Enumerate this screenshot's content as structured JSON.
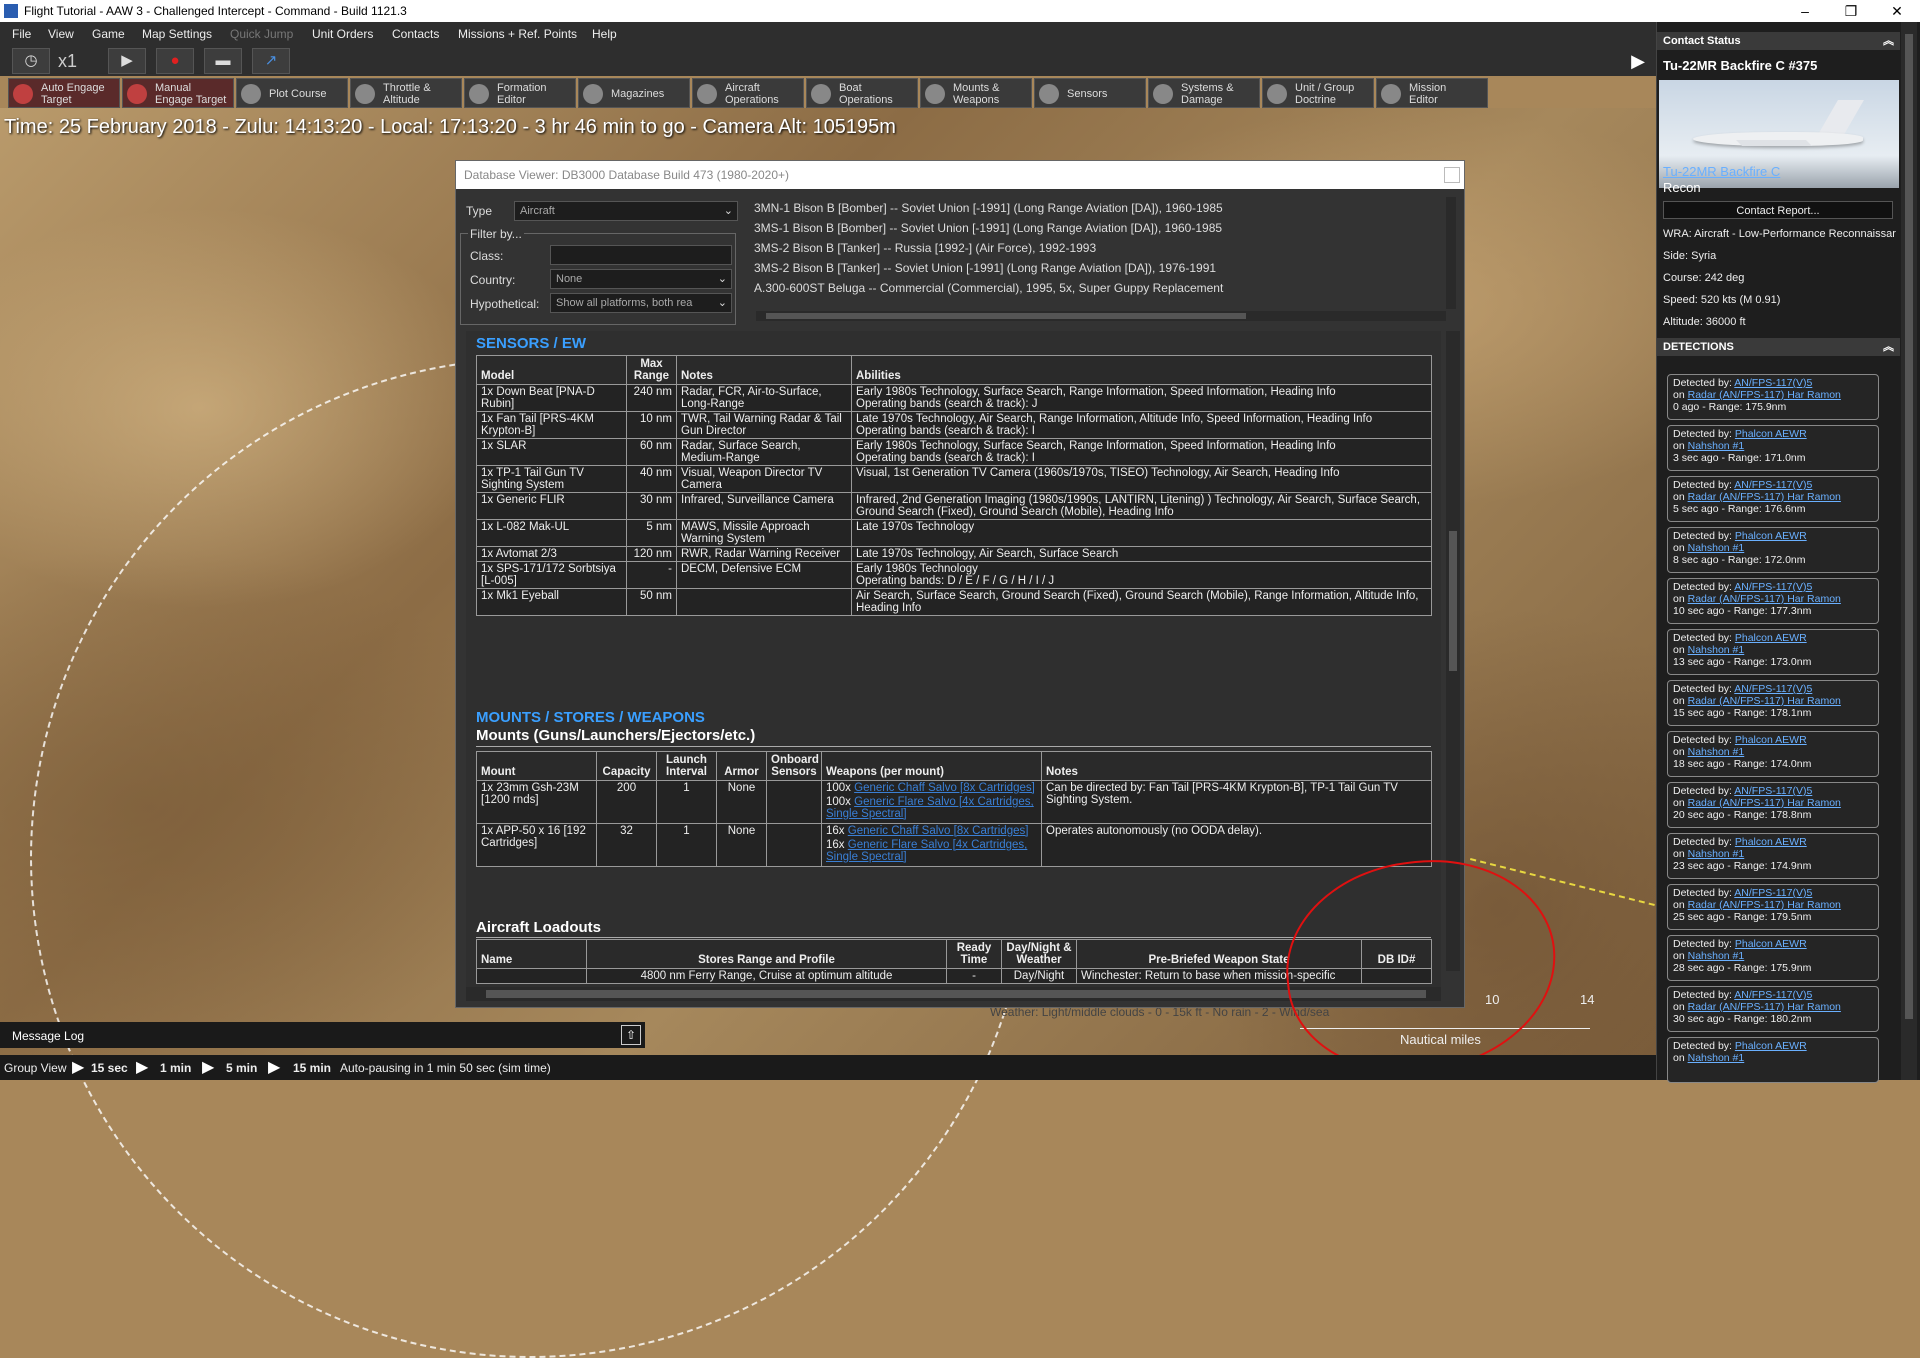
{
  "window": {
    "title": "Flight Tutorial - AAW 3 - Challenged Intercept - Command - Build 1121.3",
    "minimize": "–",
    "maximize": "❐",
    "close": "✕"
  },
  "menu": [
    "File",
    "View",
    "Game",
    "Map Settings",
    "Quick Jump",
    "Unit Orders",
    "Contacts",
    "Missions + Ref. Points",
    "Help"
  ],
  "time_controls": {
    "speed": "x1"
  },
  "toolbar": [
    {
      "label1": "Auto Engage",
      "label2": "Target"
    },
    {
      "label1": "Manual",
      "label2": "Engage Target"
    },
    {
      "label1": "Plot Course",
      "label2": ""
    },
    {
      "label1": "Throttle &",
      "label2": "Altitude"
    },
    {
      "label1": "Formation",
      "label2": "Editor"
    },
    {
      "label1": "Magazines",
      "label2": ""
    },
    {
      "label1": "Aircraft",
      "label2": "Operations"
    },
    {
      "label1": "Boat",
      "label2": "Operations"
    },
    {
      "label1": "Mounts &",
      "label2": "Weapons"
    },
    {
      "label1": "Sensors",
      "label2": ""
    },
    {
      "label1": "Systems &",
      "label2": "Damage"
    },
    {
      "label1": "Unit / Group",
      "label2": "Doctrine"
    },
    {
      "label1": "Mission",
      "label2": "Editor"
    }
  ],
  "status_line": "Time: 25 February 2018 - Zulu: 14:13:20 - Local: 17:13:20 - 3 hr 46 min to go -  Camera Alt: 105195m",
  "map": {
    "scale_label": "Nautical miles",
    "scale_ticks": [
      "10",
      "14"
    ],
    "weather": "Weather: Light/middle clouds - 0 - 15k ft - No rain - 2 - Wind/sea"
  },
  "contact_panel": {
    "header": "Contact Status",
    "name": "Tu-22MR Backfire C #375",
    "link": "Tu-22MR Backfire C",
    "role": "Recon",
    "report_button": "Contact Report...",
    "info": [
      "WRA: Aircraft - Low-Performance Reconnaissar",
      "Side: Syria",
      "Course: 242 deg",
      "Speed: 520 kts (M 0.91)",
      "Altitude: 36000 ft"
    ],
    "detections_header": "DETECTIONS",
    "detected_by_label": "Detected by:",
    "on_label": "on",
    "detections": [
      {
        "sensor": "AN/FPS-117(V)5",
        "platform": "Radar (AN/FPS-117) Har Ramon",
        "ago": "0 ago",
        "range": "- Range: 175.9nm"
      },
      {
        "sensor": "Phalcon AEWR",
        "platform": "Nahshon #1",
        "ago": "3 sec ago",
        "range": "- Range: 171.0nm"
      },
      {
        "sensor": "AN/FPS-117(V)5",
        "platform": "Radar (AN/FPS-117) Har Ramon",
        "ago": "5 sec ago",
        "range": "- Range: 176.6nm"
      },
      {
        "sensor": "Phalcon AEWR",
        "platform": "Nahshon #1",
        "ago": "8 sec ago",
        "range": "- Range: 172.0nm"
      },
      {
        "sensor": "AN/FPS-117(V)5",
        "platform": "Radar (AN/FPS-117) Har Ramon",
        "ago": "10 sec ago",
        "range": "- Range: 177.3nm"
      },
      {
        "sensor": "Phalcon AEWR",
        "platform": "Nahshon #1",
        "ago": "13 sec ago",
        "range": "- Range: 173.0nm"
      },
      {
        "sensor": "AN/FPS-117(V)5",
        "platform": "Radar (AN/FPS-117) Har Ramon",
        "ago": "15 sec ago",
        "range": "- Range: 178.1nm"
      },
      {
        "sensor": "Phalcon AEWR",
        "platform": "Nahshon #1",
        "ago": "18 sec ago",
        "range": "- Range: 174.0nm"
      },
      {
        "sensor": "AN/FPS-117(V)5",
        "platform": "Radar (AN/FPS-117) Har Ramon",
        "ago": "20 sec ago",
        "range": "- Range: 178.8nm"
      },
      {
        "sensor": "Phalcon AEWR",
        "platform": "Nahshon #1",
        "ago": "23 sec ago",
        "range": "- Range: 174.9nm"
      },
      {
        "sensor": "AN/FPS-117(V)5",
        "platform": "Radar (AN/FPS-117) Har Ramon",
        "ago": "25 sec ago",
        "range": "- Range: 179.5nm"
      },
      {
        "sensor": "Phalcon AEWR",
        "platform": "Nahshon #1",
        "ago": "28 sec ago",
        "range": "- Range: 175.9nm"
      },
      {
        "sensor": "AN/FPS-117(V)5",
        "platform": "Radar (AN/FPS-117) Har Ramon",
        "ago": "30 sec ago",
        "range": "- Range: 180.2nm"
      },
      {
        "sensor": "Phalcon AEWR",
        "platform": "Nahshon #1",
        "ago": "",
        "range": ""
      }
    ]
  },
  "db_viewer": {
    "title": "Database Viewer: DB3000 Database Build 473 (1980-2020+)",
    "type_label": "Type",
    "type_value": "Aircraft",
    "filter_label": "Filter by...",
    "class_label": "Class:",
    "country_label": "Country:",
    "country_value": "None",
    "hypothetical_label": "Hypothetical:",
    "hypothetical_value": "Show all platforms, both rea",
    "platforms": [
      "3MN-1 Bison B [Bomber] -- Soviet Union [-1991] (Long Range Aviation [DA]), 1960-1985",
      "3MS-1 Bison B [Bomber] -- Soviet Union [-1991] (Long Range Aviation [DA]), 1960-1985",
      "3MS-2 Bison B [Tanker] -- Russia [1992-] (Air Force), 1992-1993",
      "3MS-2 Bison B [Tanker] -- Soviet Union [-1991] (Long Range Aviation [DA]), 1976-1991",
      "A.300-600ST Beluga -- Commercial (Commercial), 1995, 5x, Super Guppy Replacement"
    ],
    "sensors_title": "SENSORS / EW",
    "sensors_headers": [
      "Model",
      "Max Range",
      "Notes",
      "Abilities"
    ],
    "sensors": [
      {
        "model": "1x Down Beat [PNA-D Rubin]",
        "range": "240 nm",
        "notes": "Radar, FCR, Air-to-Surface, Long-Range",
        "abilities": "Early 1980s Technology, Surface Search, Range Information, Speed Information, Heading Info",
        "bands": "Operating bands (search & track): J"
      },
      {
        "model": "1x Fan Tail [PRS-4KM Krypton-B]",
        "range": "10 nm",
        "notes": "TWR, Tail Warning Radar & Tail Gun Director",
        "abilities": "Late 1970s Technology, Air Search, Range Information, Altitude Info, Speed Information, Heading Info",
        "bands": "Operating bands (search & track): I"
      },
      {
        "model": "1x SLAR",
        "range": "60 nm",
        "notes": "Radar, Surface Search, Medium-Range",
        "abilities": "Early 1980s Technology, Surface Search, Range Information, Speed Information, Heading Info",
        "bands": "Operating bands (search & track): I"
      },
      {
        "model": "1x TP-1 Tail Gun TV Sighting System",
        "range": "40 nm",
        "notes": "Visual, Weapon Director TV Camera",
        "abilities": "Visual, 1st Generation TV Camera (1960s/1970s, TISEO) Technology, Air Search, Heading Info",
        "bands": ""
      },
      {
        "model": "1x Generic FLIR",
        "range": "30 nm",
        "notes": "Infrared, Surveillance Camera",
        "abilities": "Infrared, 2nd Generation Imaging (1980s/1990s, LANTIRN, Litening) ) Technology, Air Search, Surface Search, Ground Search (Fixed), Ground Search (Mobile), Heading Info",
        "bands": ""
      },
      {
        "model": "1x L-082 Mak-UL",
        "range": "5 nm",
        "notes": "MAWS, Missile Approach Warning System",
        "abilities": "Late 1970s Technology",
        "bands": ""
      },
      {
        "model": "1x Avtomat 2/3",
        "range": "120 nm",
        "notes": "RWR, Radar Warning Receiver",
        "abilities": "Late 1970s Technology, Air Search, Surface Search",
        "bands": ""
      },
      {
        "model": "1x SPS-171/172 Sorbtsiya [L-005]",
        "range": "-",
        "notes": "DECM, Defensive ECM",
        "abilities": "Early 1980s Technology",
        "bands": "Operating bands: D / E / F / G / H / I / J"
      },
      {
        "model": "1x Mk1 Eyeball",
        "range": "50 nm",
        "notes": "",
        "abilities": "Air Search, Surface Search, Ground Search (Fixed), Ground Search (Mobile), Range Information, Altitude Info, Heading Info",
        "bands": ""
      }
    ],
    "mounts_title": "MOUNTS / STORES / WEAPONS",
    "mounts_subtitle": "Mounts (Guns/Launchers/Ejectors/etc.)",
    "mounts_headers": [
      "Mount",
      "Capacity",
      "Launch Interval",
      "Armor",
      "Onboard Sensors",
      "Weapons (per mount)",
      "Notes"
    ],
    "mounts": [
      {
        "mount": "1x 23mm Gsh-23M [1200 rnds]",
        "capacity": "200",
        "interval": "1",
        "armor": "None",
        "sensors": "",
        "w1_qty": "100x",
        "w1": "Generic Chaff Salvo [8x Cartridges]",
        "w2_qty": "100x",
        "w2": "Generic Flare Salvo [4x Cartridges, Single Spectral]",
        "notes": "Can be directed by: Fan Tail [PRS-4KM Krypton-B], TP-1 Tail Gun TV Sighting System."
      },
      {
        "mount": "1x APP-50 x 16 [192 Cartridges]",
        "capacity": "32",
        "interval": "1",
        "armor": "None",
        "sensors": "",
        "w1_qty": "16x",
        "w1": "Generic Chaff Salvo [8x Cartridges]",
        "w2_qty": "16x",
        "w2": "Generic Flare Salvo [4x Cartridges, Single Spectral]",
        "notes": "Operates autonomously (no OODA delay)."
      }
    ],
    "loadouts_title": "Aircraft Loadouts",
    "loadouts_headers": [
      "Name",
      "Stores Range and Profile",
      "Ready Time",
      "Day/Night & Weather",
      "Pre-Briefed Weapon State",
      "DB ID#"
    ],
    "loadouts_row": {
      "name": "",
      "profile": "4800 nm Ferry Range, Cruise at optimum altitude",
      "ready": "-",
      "daynight": "Day/Night",
      "state": "Winchester: Return to base when mission-specific",
      "id": ""
    }
  },
  "message_log": {
    "label": "Message Log"
  },
  "bottom_bar": {
    "group_view": "Group View",
    "steps": [
      "15 sec",
      "1 min",
      "5 min",
      "15 min"
    ],
    "autopause": "Auto-pausing in 1 min 50 sec (sim time)"
  }
}
